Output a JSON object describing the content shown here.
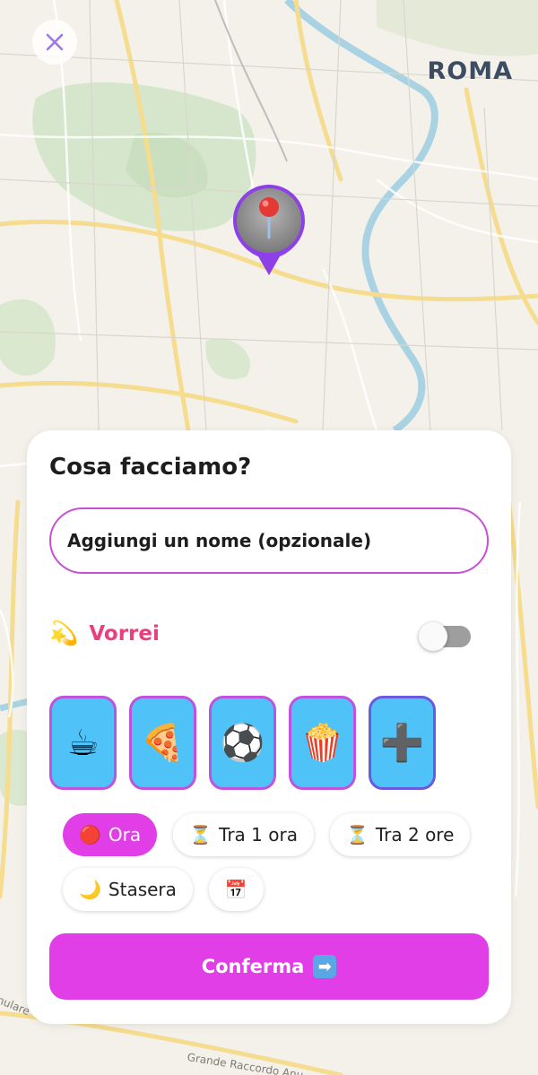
{
  "map": {
    "city_label": "ROMA",
    "road_labels": {
      "gra": "Grande Raccordo Anu",
      "anulare": "nulare"
    },
    "pin_icon": "round-pushpin-icon"
  },
  "header": {
    "close_icon": "close-icon"
  },
  "card": {
    "title": "Cosa facciamo?",
    "name_input": {
      "placeholder": "Aggiungi un nome (opzionale)",
      "value": ""
    },
    "wish": {
      "emoji": "💫",
      "label": "Vorrei",
      "toggle_on": false
    },
    "activities": [
      {
        "name": "coffee",
        "emoji": "☕"
      },
      {
        "name": "pizza",
        "emoji": "🍕"
      },
      {
        "name": "soccer",
        "emoji": "⚽"
      },
      {
        "name": "popcorn",
        "emoji": "🍿"
      },
      {
        "name": "add",
        "emoji": "➕"
      }
    ],
    "times": [
      {
        "icon": "🔴",
        "label": "Ora",
        "selected": true
      },
      {
        "icon": "⏳",
        "label": "Tra 1 ora",
        "selected": false
      },
      {
        "icon": "⏳",
        "label": "Tra 2 ore",
        "selected": false
      },
      {
        "icon": "🌙",
        "label": "Stasera",
        "selected": false
      },
      {
        "icon": "📅",
        "label": "",
        "selected": false
      }
    ],
    "confirm": {
      "label": "Conferma",
      "icon": "➡"
    }
  },
  "colors": {
    "accent": "#e23ee8",
    "wish_pink": "#ea3f7e",
    "activity_bg": "#4fc3f7",
    "activity_border": "#c052e0",
    "pin_purple": "#8d3fe8"
  }
}
